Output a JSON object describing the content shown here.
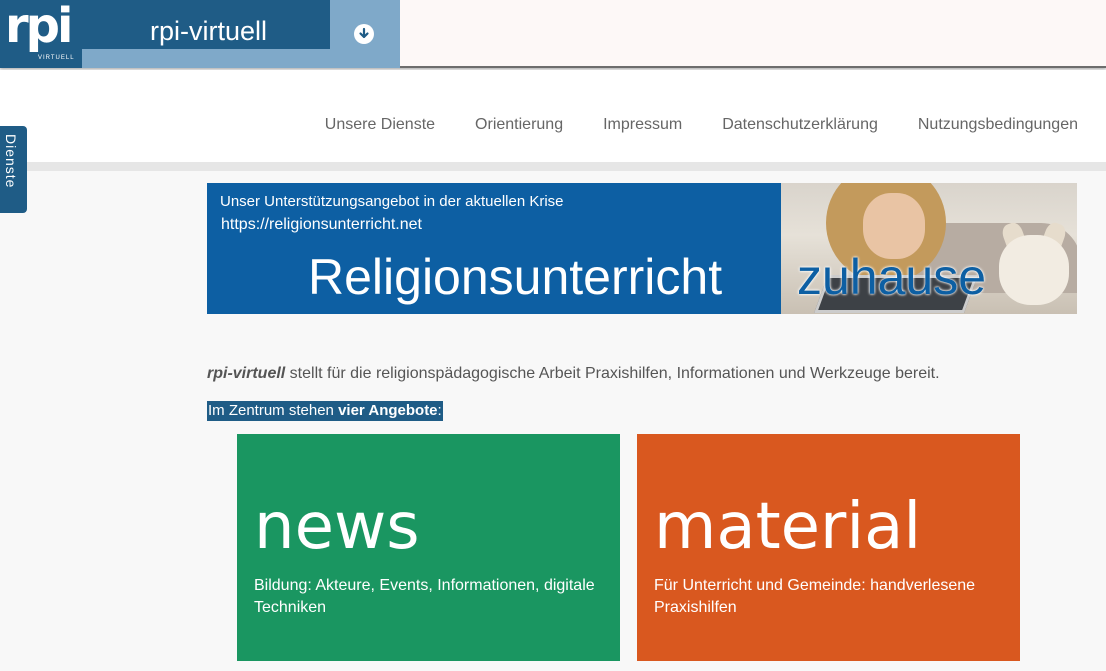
{
  "header": {
    "logo_text": "rpi",
    "logo_sub": "VIRTUELL",
    "site_title": "rpi-virtuell",
    "toggle_icon": "arrow-down-circle-icon"
  },
  "nav": {
    "items": [
      {
        "label": "Unsere Dienste"
      },
      {
        "label": "Orientierung"
      },
      {
        "label": "Impressum"
      },
      {
        "label": "Datenschutzerklärung"
      },
      {
        "label": "Nutzungsbedingungen"
      }
    ]
  },
  "side_tab": {
    "label": "Dienste"
  },
  "banner": {
    "subtitle": "Unser Unterstützungsangebot in der aktuellen Krise",
    "url": "https://religionsunterricht.net",
    "main": "Religionsunterricht",
    "accent": "zuhause"
  },
  "intro": {
    "brand": "rpi-virtuell",
    "text": " stellt für die religionspädagogische Arbeit Praxishilfen, Informationen und Werkzeuge bereit.",
    "highlight_prefix": "Im Zentrum stehen ",
    "highlight_bold": "vier Angebote",
    "highlight_suffix": ":"
  },
  "tiles": [
    {
      "title": "news",
      "description": "Bildung: Akteure, Events, Informationen, digitale Techniken",
      "color": "#1a9661"
    },
    {
      "title": "material",
      "description": "Für Unterricht und Gemeinde: handverlesene Praxishilfen",
      "color": "#d9581f"
    }
  ],
  "colors": {
    "brand_blue": "#1f5c86",
    "banner_blue": "#0d5fa3"
  }
}
